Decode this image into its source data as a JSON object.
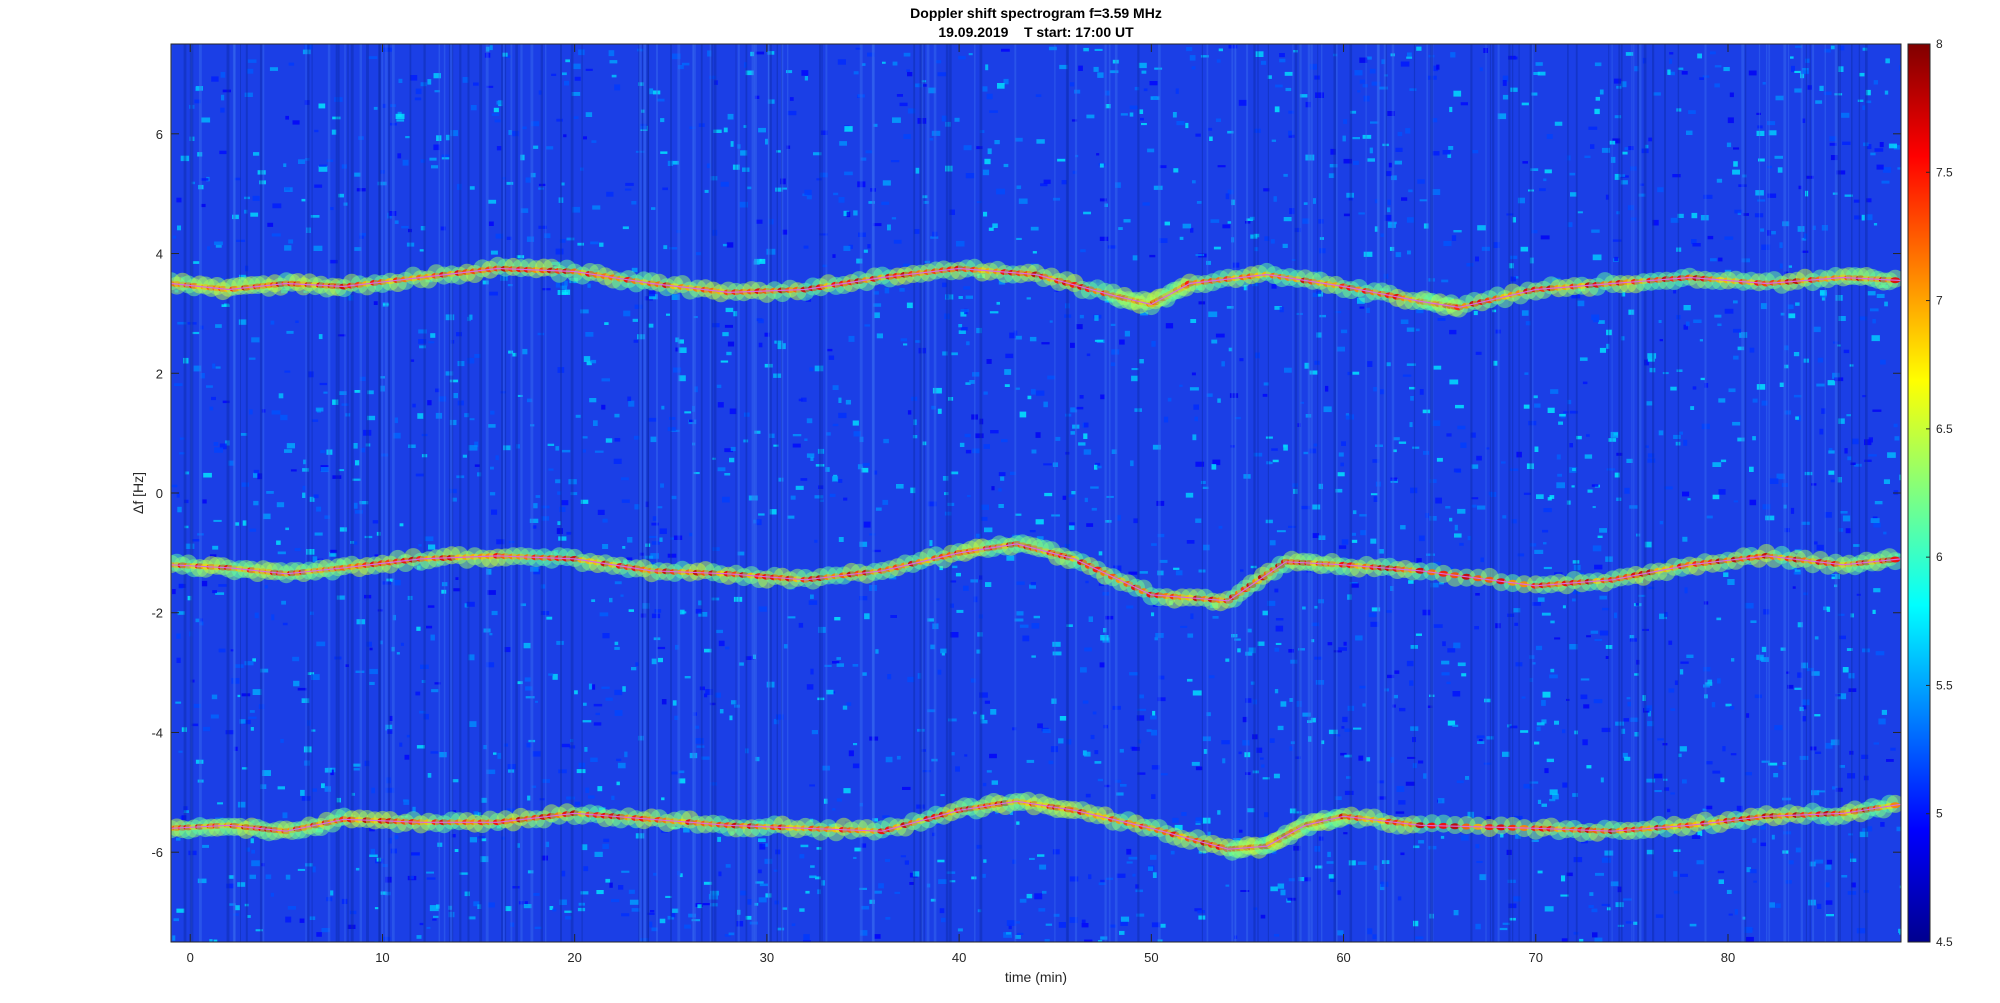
{
  "chart_data": {
    "type": "heatmap",
    "title": "Doppler shift spectrogram f=3.59 MHz",
    "subtitle": "19.09.2019    T start: 17:00 UT",
    "xlabel": "time (min)",
    "ylabel": "Δf [Hz]",
    "xlim": [
      -1,
      89
    ],
    "ylim": [
      -7.5,
      7.5
    ],
    "x_ticks": [
      0,
      10,
      20,
      30,
      40,
      50,
      60,
      70,
      80
    ],
    "y_ticks": [
      -6,
      -4,
      -2,
      0,
      2,
      4,
      6
    ],
    "colorbar": {
      "range": [
        4.5,
        8
      ],
      "ticks": [
        4.5,
        5,
        5.5,
        6,
        6.5,
        7,
        7.5,
        8
      ],
      "colormap": "jet"
    },
    "background_level": 5.2,
    "traces": [
      {
        "x": [
          -1,
          2,
          5,
          8,
          12,
          16,
          20,
          24,
          28,
          32,
          36,
          40,
          44,
          48,
          50,
          52,
          56,
          60,
          64,
          66,
          70,
          74,
          78,
          82,
          86,
          89
        ],
        "y": [
          3.5,
          3.4,
          3.5,
          3.45,
          3.6,
          3.75,
          3.7,
          3.5,
          3.35,
          3.4,
          3.6,
          3.75,
          3.65,
          3.3,
          3.15,
          3.5,
          3.65,
          3.45,
          3.2,
          3.1,
          3.4,
          3.5,
          3.6,
          3.5,
          3.6,
          3.55
        ]
      },
      {
        "x": [
          -1,
          2,
          5,
          8,
          12,
          16,
          20,
          24,
          28,
          32,
          36,
          40,
          43,
          46,
          50,
          54,
          57,
          60,
          64,
          70,
          74,
          78,
          82,
          86,
          89
        ],
        "y": [
          -1.2,
          -1.25,
          -1.35,
          -1.25,
          -1.1,
          -1.05,
          -1.1,
          -1.3,
          -1.35,
          -1.45,
          -1.3,
          -1.0,
          -0.85,
          -1.1,
          -1.7,
          -1.8,
          -1.15,
          -1.2,
          -1.3,
          -1.55,
          -1.45,
          -1.2,
          -1.05,
          -1.2,
          -1.1
        ]
      },
      {
        "x": [
          -1,
          2,
          5,
          8,
          12,
          16,
          20,
          24,
          28,
          32,
          36,
          40,
          43,
          46,
          50,
          54,
          56,
          58,
          60,
          64,
          70,
          74,
          78,
          82,
          86,
          89
        ],
        "y": [
          -5.6,
          -5.55,
          -5.65,
          -5.45,
          -5.5,
          -5.5,
          -5.35,
          -5.45,
          -5.55,
          -5.6,
          -5.65,
          -5.3,
          -5.15,
          -5.3,
          -5.6,
          -5.95,
          -5.9,
          -5.55,
          -5.4,
          -5.55,
          -5.6,
          -5.65,
          -5.55,
          -5.4,
          -5.35,
          -5.2
        ]
      }
    ]
  }
}
